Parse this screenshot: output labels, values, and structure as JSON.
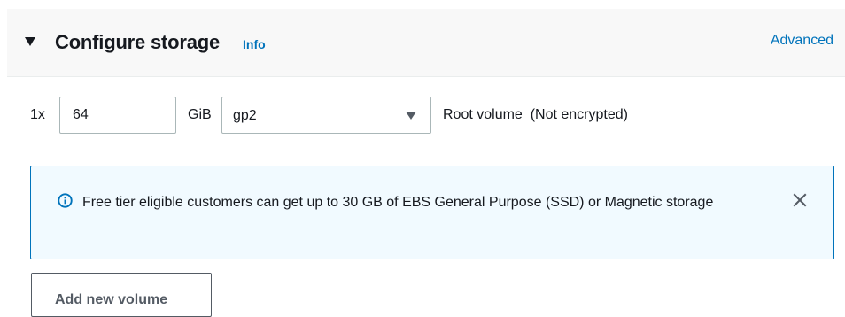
{
  "section": {
    "title": "Configure storage",
    "info_link": "Info",
    "advanced_link": "Advanced"
  },
  "volume": {
    "count_label": "1x",
    "size_value": "64",
    "size_unit": "GiB",
    "type_selected": "gp2",
    "description": "Root volume  (Not encrypted)"
  },
  "alert": {
    "message": "Free tier eligible customers can get up to 30 GB of EBS General Purpose (SSD) or Magnetic storage",
    "icon": "info-circle-icon",
    "close_icon": "close-icon"
  },
  "actions": {
    "add_volume_label": "Add new volume"
  },
  "colors": {
    "link": "#0073bb",
    "alert_bg": "#f1faff",
    "alert_border": "#0073bb",
    "header_bg": "#f8f8f8"
  }
}
